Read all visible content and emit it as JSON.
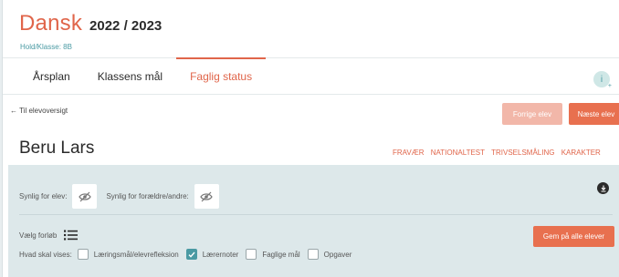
{
  "header": {
    "subject": "Dansk",
    "year": "2022 / 2023",
    "class_label": "Hold/Klasse: 8B"
  },
  "tabs": [
    {
      "label": "Årsplan",
      "active": false
    },
    {
      "label": "Klassens mål",
      "active": false
    },
    {
      "label": "Faglig status",
      "active": true
    }
  ],
  "info_icon": {
    "glyph": "i",
    "name": "info-icon"
  },
  "back_link": "← Til elevoversigt",
  "nav_buttons": {
    "prev": "Forrige elev",
    "next": "Næste elev"
  },
  "student": {
    "name": "Beru Lars"
  },
  "links": [
    "FRAVÆR",
    "NATIONALTEST",
    "TRIVSELSMÅLING",
    "KARAKTER"
  ],
  "visibility": {
    "student_label": "Synlig for elev:",
    "parents_label": "Synlig for forældre/andre:",
    "icon": "eye-slash-icon"
  },
  "download": {
    "icon": "download-icon"
  },
  "forloeb": {
    "label": "Vælg forløb",
    "icon": "list-icon"
  },
  "save_all_button": "Gem på alle elever",
  "show": {
    "label": "Hvad skal vises:",
    "options": [
      {
        "label": "Læringsmål/elevrefleksion",
        "checked": false
      },
      {
        "label": "Lærernoter",
        "checked": true
      },
      {
        "label": "Faglige mål",
        "checked": false
      },
      {
        "label": "Opgaver",
        "checked": false
      }
    ]
  },
  "colors": {
    "accent": "#e0654a",
    "button": "#e8704f",
    "button_disabled": "#f2b7a9",
    "teal": "#4a9aa3",
    "panel": "#dde8ea"
  }
}
